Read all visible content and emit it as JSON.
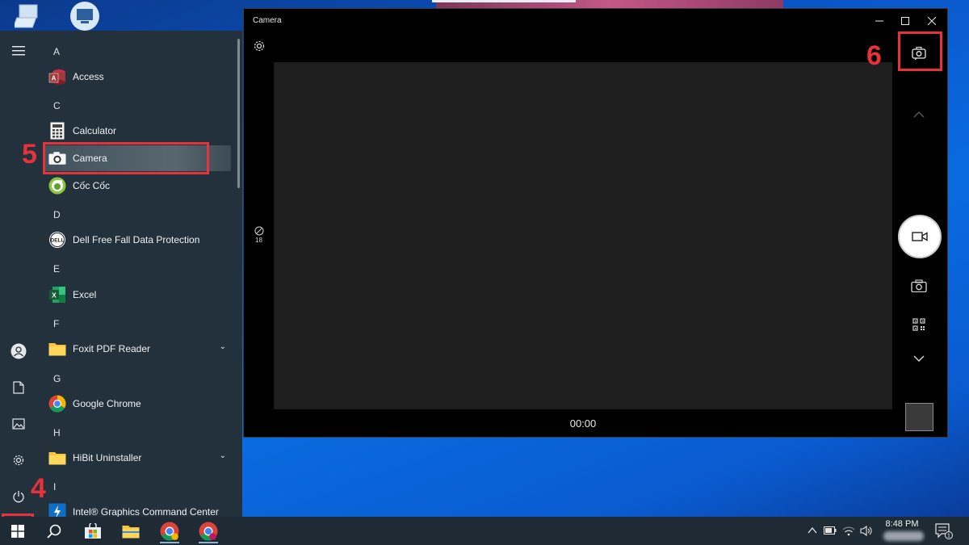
{
  "camera_window": {
    "title": "Camera",
    "timer": "00:00",
    "hdr_value": "18",
    "window_controls": [
      "minimize-icon",
      "maximize-icon",
      "close-icon"
    ],
    "side_controls": [
      "switch-camera-icon",
      "chevron-up-icon",
      "video-camera-icon",
      "camera-icon",
      "qr-code-icon",
      "chevron-down-icon"
    ]
  },
  "start_menu": {
    "rail_icons": [
      "hamburger-icon",
      "user-icon",
      "document-icon",
      "pictures-icon",
      "gear-icon",
      "power-icon"
    ],
    "groups": [
      {
        "letter": "A",
        "apps": [
          {
            "label": "Access",
            "icon": "access-icon"
          }
        ]
      },
      {
        "letter": "C",
        "apps": [
          {
            "label": "Calculator",
            "icon": "calculator-icon"
          },
          {
            "label": "Camera",
            "icon": "camera-icon",
            "selected": true
          },
          {
            "label": "Cốc Cốc",
            "icon": "coccoc-icon"
          }
        ]
      },
      {
        "letter": "D",
        "apps": [
          {
            "label": "Dell Free Fall Data Protection",
            "icon": "dell-icon"
          }
        ]
      },
      {
        "letter": "E",
        "apps": [
          {
            "label": "Excel",
            "icon": "excel-icon"
          }
        ]
      },
      {
        "letter": "F",
        "apps": [
          {
            "label": "Foxit PDF Reader",
            "icon": "folder-icon",
            "expandable": true
          }
        ]
      },
      {
        "letter": "G",
        "apps": [
          {
            "label": "Google Chrome",
            "icon": "chrome-icon"
          }
        ]
      },
      {
        "letter": "H",
        "apps": [
          {
            "label": "HiBit Uninstaller",
            "icon": "folder-icon",
            "expandable": true
          }
        ]
      },
      {
        "letter": "I",
        "apps": [
          {
            "label": "Intel® Graphics Command Center",
            "icon": "intel-graphics-icon"
          }
        ]
      }
    ]
  },
  "annotations": {
    "step4": "4",
    "step5": "5",
    "step6": "6",
    "color": "#e8323a"
  },
  "taskbar": {
    "pinned": [
      "windows-start-icon",
      "search-icon",
      "microsoft-store-icon",
      "file-explorer-icon",
      "coccoc-browser-icon",
      "chrome-icon"
    ],
    "time": "8:48 PM",
    "notification_count": "1"
  },
  "colors": {
    "start_menu_bg": "#22313c",
    "taskbar_bg": "#1f2b34",
    "camera_bg": "#000000",
    "viewport_bg": "#1e1e1e"
  }
}
